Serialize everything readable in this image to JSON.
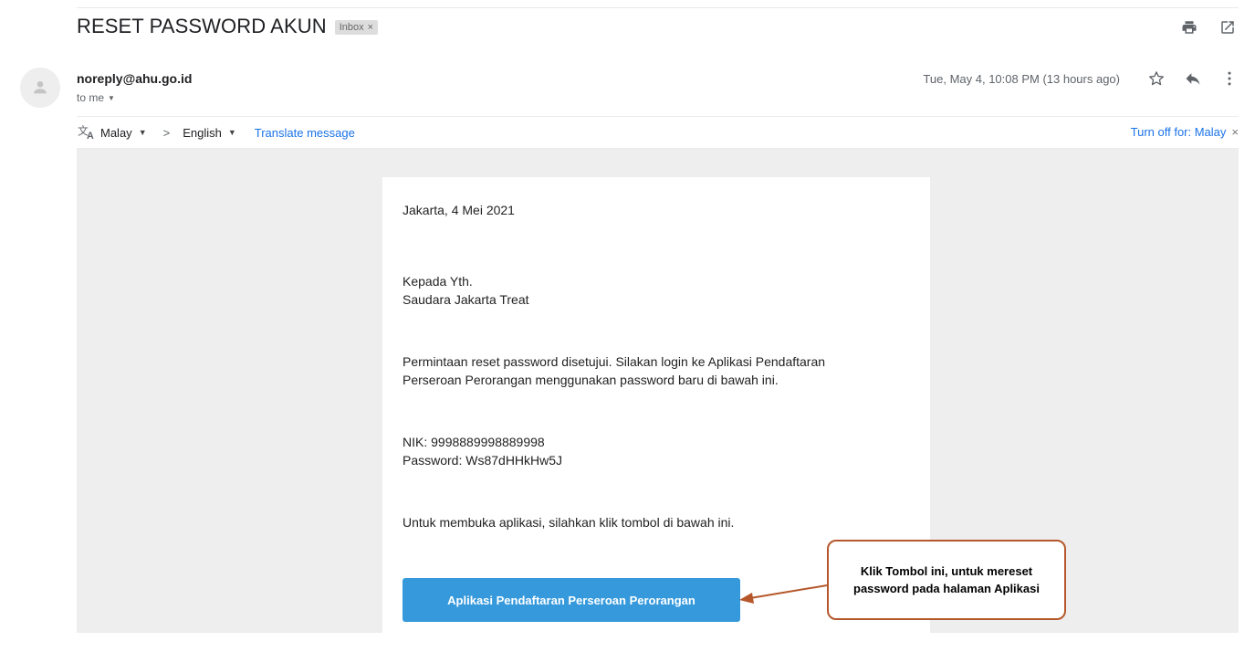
{
  "email": {
    "subject": "RESET PASSWORD AKUN",
    "label": "Inbox",
    "label_close": "×",
    "sender": "noreply@ahu.go.id",
    "recipient": "to me",
    "date": "Tue, May 4, 10:08 PM (13 hours ago)"
  },
  "translate": {
    "from_lang": "Malay",
    "arrow": ">",
    "to_lang": "English",
    "link": "Translate message",
    "turn_off": "Turn off for: Malay",
    "turn_off_close": "×"
  },
  "message": {
    "date_line": "Jakarta, 4 Mei 2021",
    "greeting_1": "Kepada Yth.",
    "greeting_2": "Saudara Jakarta Treat",
    "body_1": "Permintaan reset password disetujui. Silakan login ke Aplikasi Pendaftaran",
    "body_2": "Perseroan Perorangan menggunakan password baru di bawah ini.",
    "nik": "NIK: 9998889998889998",
    "password": "Password: Ws87dHHkHw5J",
    "open_instruction": "Untuk membuka aplikasi, silahkan klik tombol di bawah ini.",
    "button_label": "Aplikasi Pendaftaran Perseroan Perorangan"
  },
  "annotation": {
    "line_1": "Klik Tombol ini, untuk mereset",
    "line_2": "password pada halaman Aplikasi"
  },
  "colors": {
    "button": "#3599dc",
    "link": "#1a73e8",
    "callout_border": "#b5572b"
  },
  "icons": [
    "print-icon",
    "open-new-window-icon",
    "avatar-icon",
    "star-icon",
    "reply-icon",
    "more-vert-icon",
    "translate-icon"
  ]
}
